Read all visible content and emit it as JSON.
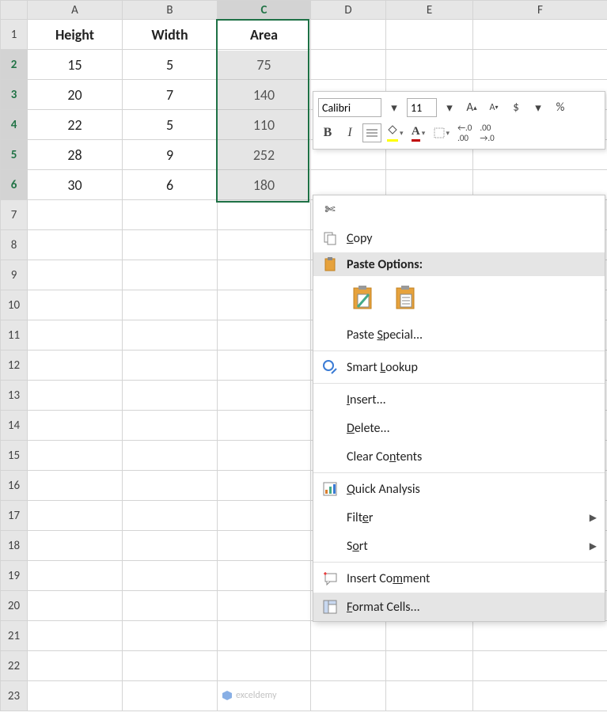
{
  "columns": [
    "A",
    "B",
    "C",
    "D",
    "E",
    "F"
  ],
  "rows": [
    "1",
    "2",
    "3",
    "4",
    "5",
    "6",
    "7",
    "8",
    "9",
    "10",
    "11",
    "12",
    "13",
    "14",
    "15",
    "16",
    "17",
    "18",
    "19",
    "20",
    "21",
    "22",
    "23"
  ],
  "table": {
    "headers": {
      "A": "Height",
      "B": "Width",
      "C": "Area"
    },
    "data": [
      {
        "A": "15",
        "B": "5",
        "C": "75"
      },
      {
        "A": "20",
        "B": "7",
        "C": "140"
      },
      {
        "A": "22",
        "B": "5",
        "C": "110"
      },
      {
        "A": "28",
        "B": "9",
        "C": "252"
      },
      {
        "A": "30",
        "B": "6",
        "C": "180"
      }
    ]
  },
  "minitoolbar": {
    "font": "Calibri",
    "size": "11",
    "incfont_icon": "A▴",
    "decfont_icon": "A▾",
    "currency": "$",
    "percent": "%",
    "bold": "B",
    "italic": "I",
    "fontcolor_letter": "A",
    "incdec_icon": "…",
    "dec0_icon": ".0",
    "dec00_icon": ".00"
  },
  "contextmenu": {
    "cut": "Cut",
    "copy": "Copy",
    "paste_options": "Paste Options:",
    "paste_special": "Paste Special...",
    "smart_lookup": "Smart Lookup",
    "insert": "Insert...",
    "delete": "Delete...",
    "clear_contents": "Clear Contents",
    "quick_analysis": "Quick Analysis",
    "filter": "Filter",
    "sort": "Sort",
    "insert_comment": "Insert Comment",
    "format_cells": "Format Cells..."
  },
  "watermark": "exceldemy"
}
